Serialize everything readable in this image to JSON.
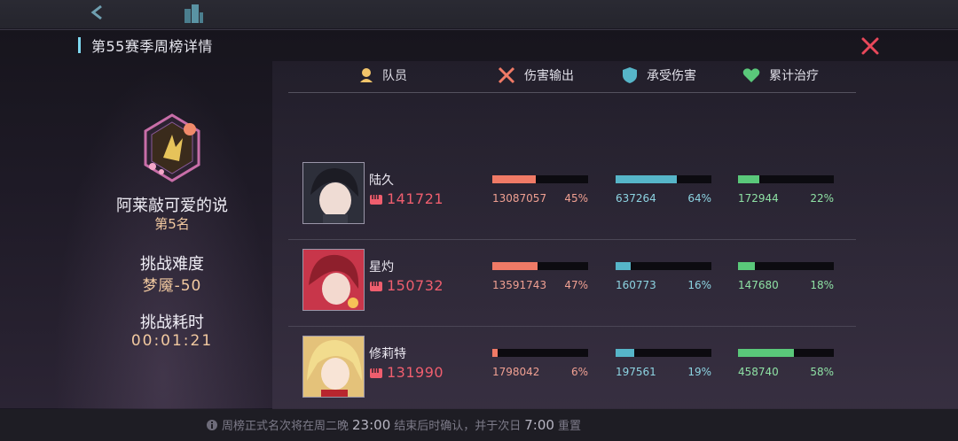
{
  "header": {
    "title": "第55赛季周榜详情"
  },
  "player": {
    "name": "阿莱敲可爱的说",
    "rank": "第5名",
    "difficulty_label": "挑战难度",
    "difficulty_value": "梦魇-50",
    "time_label": "挑战耗时",
    "time_value": "00:01:21"
  },
  "columns": {
    "member": "队员",
    "damage": "伤害输出",
    "taken": "承受伤害",
    "heal": "累计治疗"
  },
  "rows": [
    {
      "name": "陆久",
      "power": "141721",
      "damage": {
        "value": "13087057",
        "pct": "45%",
        "fill": 0.45
      },
      "taken": {
        "value": "637264",
        "pct": "64%",
        "fill": 0.64
      },
      "heal": {
        "value": "172944",
        "pct": "22%",
        "fill": 0.22
      }
    },
    {
      "name": "星灼",
      "power": "150732",
      "damage": {
        "value": "13591743",
        "pct": "47%",
        "fill": 0.47
      },
      "taken": {
        "value": "160773",
        "pct": "16%",
        "fill": 0.16
      },
      "heal": {
        "value": "147680",
        "pct": "18%",
        "fill": 0.18
      }
    },
    {
      "name": "修莉特",
      "power": "131990",
      "damage": {
        "value": "1798042",
        "pct": "6%",
        "fill": 0.06
      },
      "taken": {
        "value": "197561",
        "pct": "19%",
        "fill": 0.19
      },
      "heal": {
        "value": "458740",
        "pct": "58%",
        "fill": 0.58
      }
    }
  ],
  "footer": {
    "pre": "周榜正式名次将在周二晚",
    "time1": "23:00",
    "mid": "结束后时确认，并于次日",
    "time2": "7:00",
    "post": "重置"
  },
  "colors": {
    "accent": "#7fd8f0",
    "damage": "#f07a66",
    "taken": "#56b5c8",
    "heal": "#5ac87a",
    "power": "#ef5e6e",
    "gold": "#f2c9a0"
  }
}
